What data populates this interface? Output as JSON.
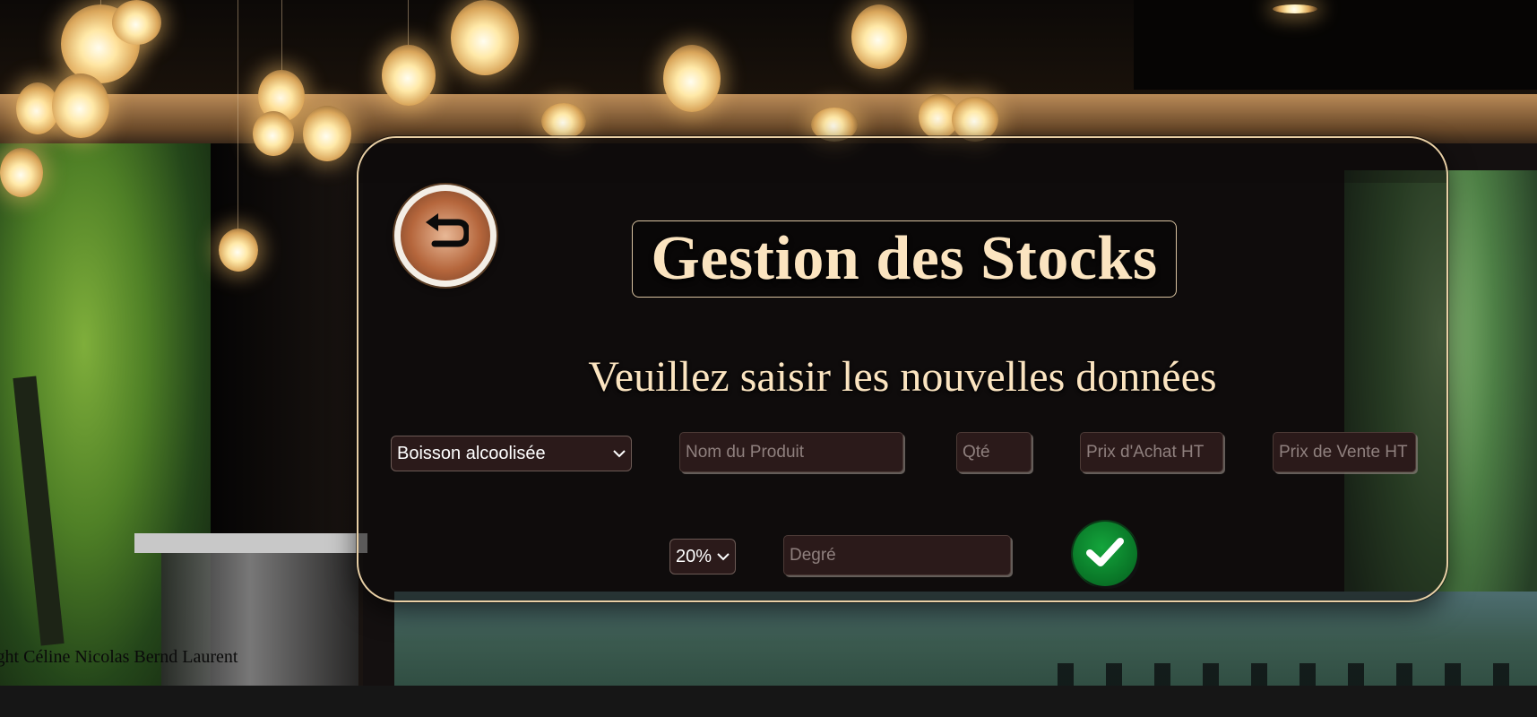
{
  "header": {
    "title": "Gestion des Stocks",
    "subtitle": "Veuillez saisir les nouvelles données"
  },
  "back_button": {
    "icon": "undo-arrow-icon"
  },
  "form": {
    "category": {
      "selected": "Boisson alcoolisée"
    },
    "product_name": {
      "placeholder": "Nom du Produit"
    },
    "quantity": {
      "placeholder": "Qté"
    },
    "purchase_price": {
      "placeholder": "Prix d'Achat HT"
    },
    "sale_price": {
      "placeholder": "Prix de Vente HT"
    },
    "vat": {
      "selected": "20%"
    },
    "degree": {
      "placeholder": "Degré"
    },
    "submit": {
      "icon": "checkmark-icon"
    }
  },
  "footer": {
    "text": "ight Céline Nicolas Bernd Laurent"
  },
  "colors": {
    "accent_text": "#fbe4c0",
    "panel_border": "#e8cfa5",
    "field_bg": "#2b1a1a",
    "confirm_green": "#0a7a29"
  }
}
